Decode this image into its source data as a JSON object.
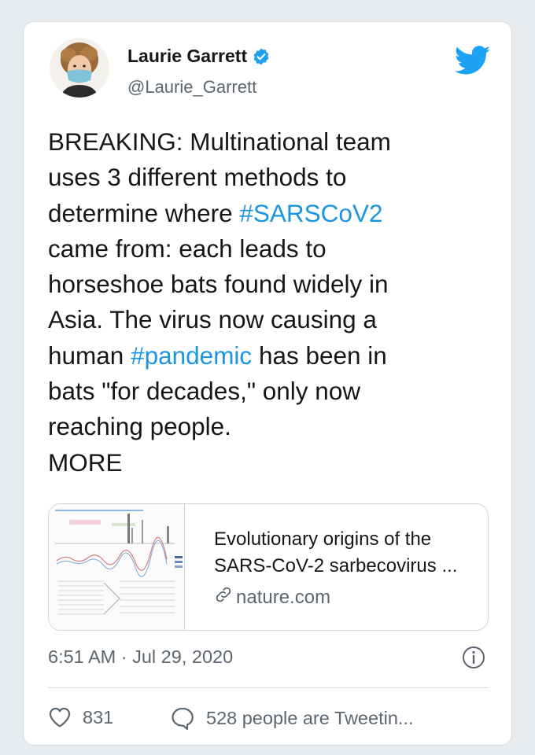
{
  "tweet": {
    "author": {
      "name": "Laurie Garrett",
      "handle": "@Laurie_Garrett",
      "avatar_icon": "avatar-woman-with-mask",
      "verified_icon": "verified-badge-icon"
    },
    "brand_icon": "twitter-bird-icon",
    "text_lines": [
      [
        {
          "t": "BREAKING: Multinational team"
        }
      ],
      [
        {
          "t": "uses 3 different methods to"
        }
      ],
      [
        {
          "t": "determine where "
        },
        {
          "t": "#SARSCoV2",
          "tag": true
        }
      ],
      [
        {
          "t": "came from: each leads to"
        }
      ],
      [
        {
          "t": "horseshoe bats found widely in"
        }
      ],
      [
        {
          "t": "Asia. The virus now causing a"
        }
      ],
      [
        {
          "t": "human "
        },
        {
          "t": "#pandemic",
          "tag": true
        },
        {
          "t": " has been in"
        }
      ],
      [
        {
          "t": "bats \"for decades,\" only now"
        }
      ],
      [
        {
          "t": "reaching people."
        }
      ],
      [
        {
          "t": "MORE"
        }
      ]
    ],
    "link_card": {
      "title_lines": [
        "Evolutionary origins of the",
        "SARS-CoV-2 sarbecovirus ..."
      ],
      "domain": "nature.com",
      "domain_icon": "link-icon"
    },
    "timestamp": "6:51 AM · Jul 29, 2020",
    "info_icon": "info-icon",
    "likes": "831",
    "like_icon": "heart-icon",
    "reply_icon": "reply-bubble-icon",
    "talking": "528 people are Tweetin..."
  },
  "colors": {
    "accent": "#1da1f2",
    "hashtag": "#1b95e0",
    "muted": "#5b6670",
    "text": "#14171a",
    "border": "#d6dbe0"
  }
}
